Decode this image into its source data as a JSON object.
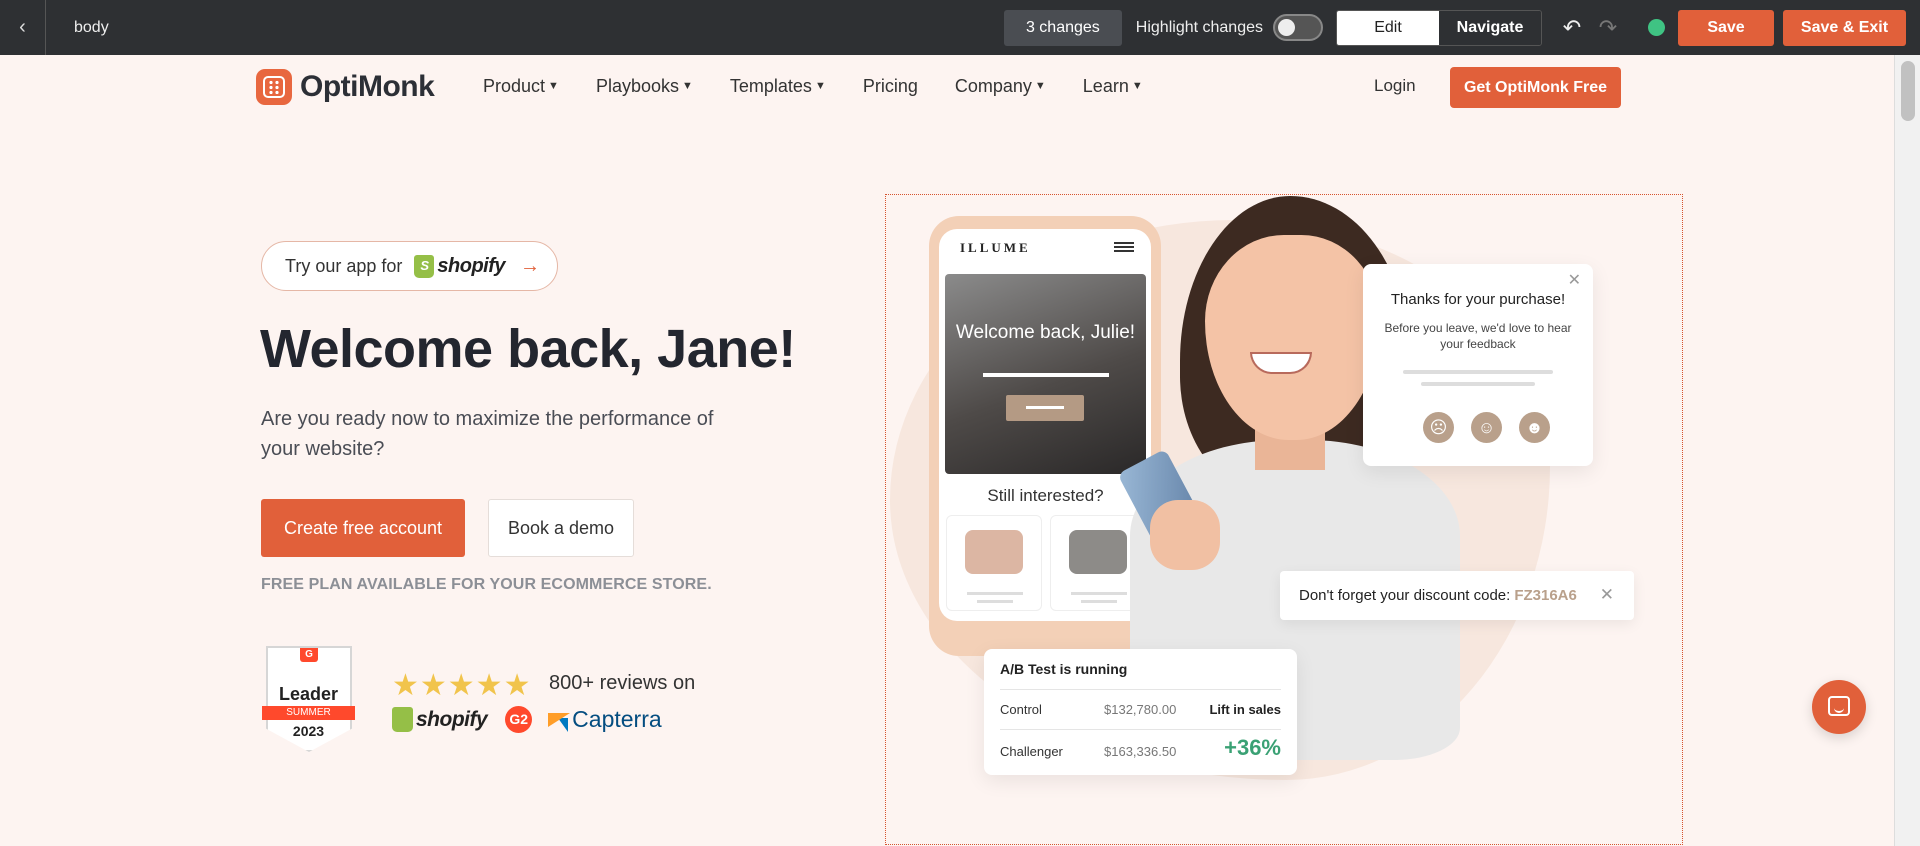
{
  "toolbar": {
    "back_icon": "chevron-left-icon",
    "context_label": "body",
    "changes_label": "3 changes",
    "highlight_label": "Highlight changes",
    "highlight_on": false,
    "mode_edit": "Edit",
    "mode_navigate": "Navigate",
    "save_label": "Save",
    "save_exit_label": "Save & Exit",
    "status_color": "#3fc383"
  },
  "site": {
    "logo_text": "OptiMonk",
    "nav": [
      {
        "label": "Product",
        "dropdown": true
      },
      {
        "label": "Playbooks",
        "dropdown": true
      },
      {
        "label": "Templates",
        "dropdown": true
      },
      {
        "label": "Pricing",
        "dropdown": false
      },
      {
        "label": "Company",
        "dropdown": true
      },
      {
        "label": "Learn",
        "dropdown": true
      }
    ],
    "login_label": "Login",
    "cta_label": "Get OptiMonk Free",
    "accent": "#e1603a"
  },
  "hero": {
    "try_prefix": "Try our app for",
    "try_brand": "shopify",
    "title": "Welcome back, Jane!",
    "subtitle": "Are you ready now to maximize the performance of your website?",
    "primary_cta": "Create free account",
    "secondary_cta": "Book a demo",
    "free_plan": "FREE PLAN AVAILABLE FOR YOUR ECOMMERCE STORE.",
    "badge": {
      "brand": "G",
      "leader": "Leader",
      "season": "SUMMER",
      "year": "2023"
    },
    "stars": "★★★★★",
    "reviews_text": "800+ reviews on",
    "brands": {
      "shopify": "shopify",
      "g2": "G2",
      "capterra": "Capterra"
    }
  },
  "mockup": {
    "store_name": "ILLUME",
    "promo_text": "Welcome back, Julie!",
    "still_interested": "Still interested?",
    "feedback": {
      "title": "Thanks for your purchase!",
      "subtitle": "Before you leave, we'd love to hear your feedback",
      "faces": [
        "☹",
        "☺",
        "☻"
      ]
    },
    "discount": {
      "text": "Don't forget your discount code:",
      "code": "FZ316A6"
    },
    "abtest": {
      "title": "A/B Test is running",
      "control_label": "Control",
      "control_value": "$132,780.00",
      "lift_label": "Lift in sales",
      "challenger_label": "Challenger",
      "challenger_value": "$163,336.50",
      "lift_value": "+36%"
    }
  }
}
